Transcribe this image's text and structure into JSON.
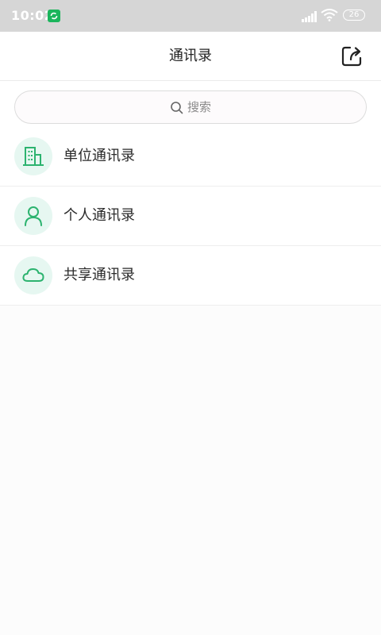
{
  "status_bar": {
    "time": "10:02",
    "battery": "26"
  },
  "header": {
    "title": "通讯录",
    "share_icon": "share-export-icon"
  },
  "search": {
    "placeholder": "搜索",
    "icon": "search-icon"
  },
  "contacts_menu": {
    "items": [
      {
        "label": "单位通讯录",
        "icon": "building-icon"
      },
      {
        "label": "个人通讯录",
        "icon": "person-icon"
      },
      {
        "label": "共享通讯录",
        "icon": "cloud-icon"
      }
    ]
  },
  "colors": {
    "accent_green": "#2cb36f",
    "icon_circle_bg": "#e6f7f1",
    "status_bar_bg": "#d6d6d6"
  }
}
